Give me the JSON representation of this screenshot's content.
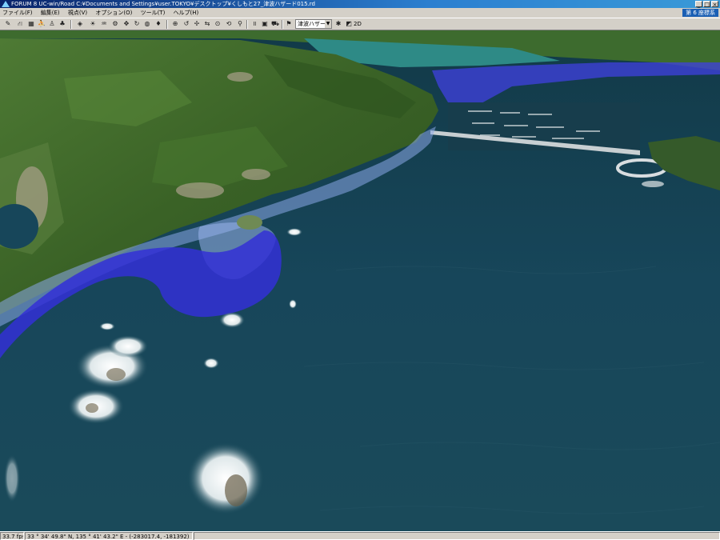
{
  "window": {
    "title": "FORUM 8    UC-win/Road    C:¥Documents and Settings¥user.TOKYO¥デスクトップ¥くしもと27_津波ハザード015.rd",
    "controls": [
      "_",
      "□",
      "×"
    ]
  },
  "menu": {
    "items": [
      "ファイル(F)",
      "編集(E)",
      "視点(V)",
      "オプション(O)",
      "ツール(T)",
      "ヘルプ(H)"
    ],
    "badge": "第 6 座標系"
  },
  "toolbar": {
    "dropdown_value": "津波ハザー",
    "mode_2d": "2D"
  },
  "status": {
    "fps": "33.7 fps",
    "coords": "33 °  34' 49.8\" N, 135 °  41' 43.2\" E  - (-283017.4, -181392)"
  },
  "colors": {
    "titlebar": "#0a246a",
    "sea": "#14404e",
    "hazard_deep": "#3a38d8",
    "hazard_light": "#7a9ee0",
    "land": "#3f6a2c"
  }
}
